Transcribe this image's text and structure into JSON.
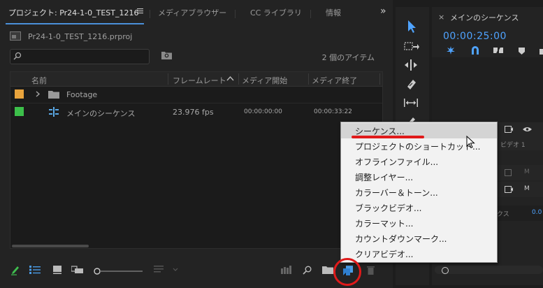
{
  "tabs": {
    "project": "プロジェクト: Pr24-1-0_TEST_1216",
    "media_browser": "メディアブラウザー",
    "cc_libraries": "CC ライブラリ",
    "info": "情報",
    "overflow": "»"
  },
  "project": {
    "filename": "Pr24-1-0_TEST_1216.prproj",
    "item_count": "2 個のアイテム",
    "search_value": "",
    "columns": {
      "name": "名前",
      "framerate": "フレームレート",
      "media_start": "メディア開始",
      "media_end": "メディア終了"
    },
    "rows": [
      {
        "label_color": "#e8a33c",
        "name": "Footage",
        "framerate": "",
        "media_start": "",
        "media_end": ""
      },
      {
        "label_color": "#3cbf4a",
        "name": "メインのシーケンス",
        "framerate": "23.976 fps",
        "media_start": "00:00:00:00",
        "media_end": "00:00:33:22"
      }
    ]
  },
  "timeline": {
    "title": "メインのシーケンス",
    "timecode": "00:00:25:00",
    "track_video1": "ビデオ 1",
    "track_m": "M",
    "track_partial": "ックス",
    "value_partial": "0.0"
  },
  "menu": {
    "items": [
      "シーケンス...",
      "プロジェクトのショートカット...",
      "オフラインファイル...",
      "調整レイヤー...",
      "カラーバー＆トーン...",
      "ブラックビデオ...",
      "カラーマット...",
      "カウントダウンマーク...",
      "クリアビデオ..."
    ],
    "highlighted_index": 0
  },
  "colors": {
    "accent": "#4fa3ff",
    "annotation_red": "#e01a1a",
    "label_orange": "#e8a33c",
    "label_green": "#3cbf4a"
  }
}
